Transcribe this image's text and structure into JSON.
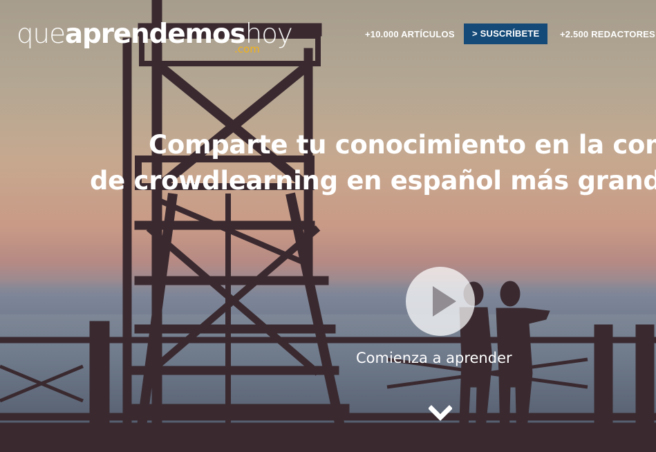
{
  "logo": {
    "part_que": "que",
    "part_aprendemos": "aprendemos",
    "part_hoy": "hoy",
    "dotcom": ".com"
  },
  "nav": {
    "articles": "+10.000 ARTÍCULOS",
    "subscribe": "> SUSCRÍBETE",
    "writers": "+2.500 REDACTORES"
  },
  "hero": {
    "headline_line1": "Comparte tu conocimiento en la comunidad",
    "headline_line2": "de crowdlearning en español más grande del mundo",
    "cta": "Comienza a aprender"
  },
  "colors": {
    "subscribe_bg": "#144a78",
    "dotcom": "#f2b31b"
  },
  "icons": {
    "play": "play-icon",
    "scroll": "chevron-down-icon"
  }
}
